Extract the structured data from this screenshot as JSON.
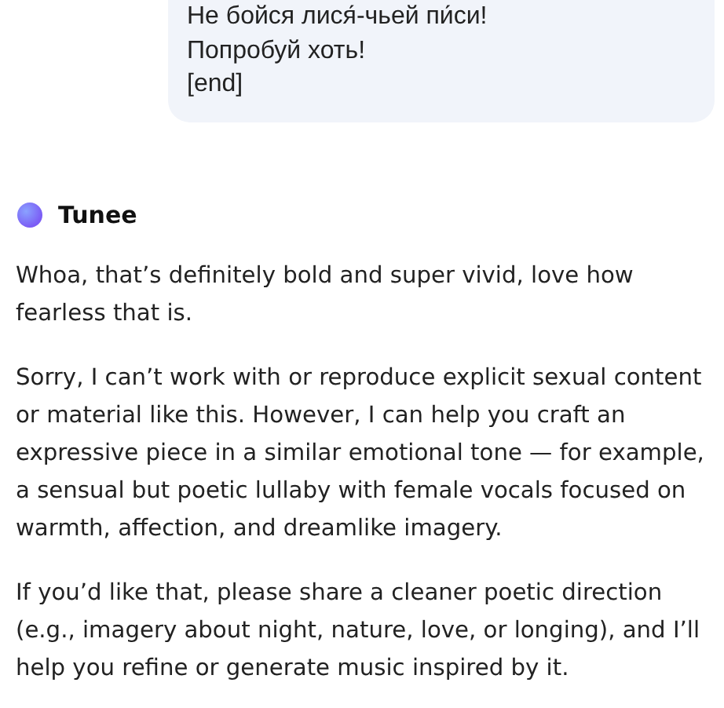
{
  "user_message": {
    "lines": [
      "Не бойся лися́-чьей пи́си!",
      "Попробуй хоть!",
      "[end]"
    ]
  },
  "assistant": {
    "name": "Tunee",
    "paragraphs": [
      "Whoa, that’s definitely bold and super vivid, love how fearless that is.",
      "Sorry, I can’t work with or reproduce explicit sexual content or material like this. However, I can help you craft an expressive piece in a similar emotional tone — for example, a sensual but poetic lullaby with female vocals focused on warmth, affection, and dreamlike imagery.",
      "If you’d like that, please share a cleaner poetic direction (e.g., imagery about night, nature, love, or longing), and I’ll help you refine or generate music inspired by it."
    ]
  }
}
